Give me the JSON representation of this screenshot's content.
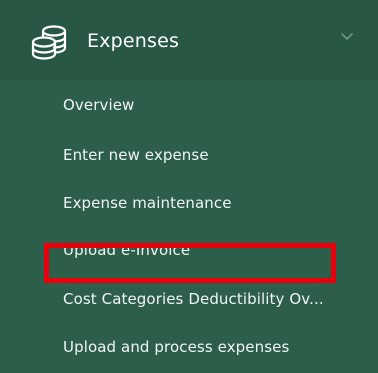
{
  "section": {
    "label": "Expenses",
    "icon": "coins-stack-icon",
    "expanded_icon": "chevron-down-icon"
  },
  "menu": {
    "items": [
      {
        "label": "Overview"
      },
      {
        "label": "Enter new expense"
      },
      {
        "label": "Expense maintenance"
      },
      {
        "label": "Upload e-Invoice"
      },
      {
        "label": "Cost Categories Deductibility Ov..."
      },
      {
        "label": "Upload and process expenses"
      }
    ]
  },
  "colors": {
    "sidebar_background": "#2c5e4a",
    "header_background": "#285744",
    "text": "#ffffff",
    "highlight": "#e8000d"
  }
}
